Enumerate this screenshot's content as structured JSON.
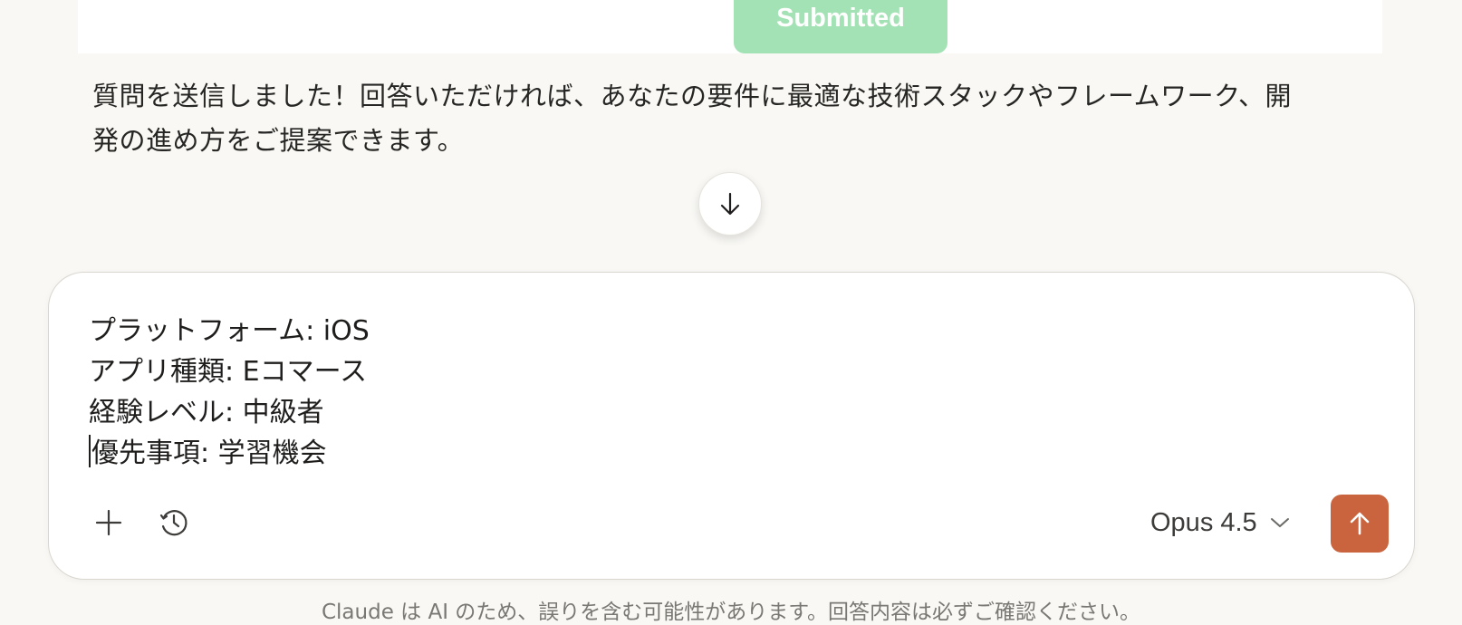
{
  "top_card": {
    "submitted_label": "Submitted"
  },
  "assistant": {
    "message": "質問を送信しました！回答いただければ、あなたの要件に最適な技術スタックやフレームワーク、開発の進め方をご提案できます。"
  },
  "scroll_down": {
    "icon": "arrow-down-icon"
  },
  "composer": {
    "lines": [
      "プラットフォーム: iOS",
      "アプリ種類: Eコマース",
      "経験レベル: 中級者",
      "優先事項: 学習機会"
    ],
    "add_icon": "plus-icon",
    "history_icon": "clock-icon",
    "model_label": "Opus 4.5",
    "send_icon": "arrow-up-icon",
    "send_color": "#c9643f"
  },
  "footer": {
    "disclaimer": "Claude は AI のため、誤りを含む可能性があります。回答内容は必ずご確認ください。"
  }
}
